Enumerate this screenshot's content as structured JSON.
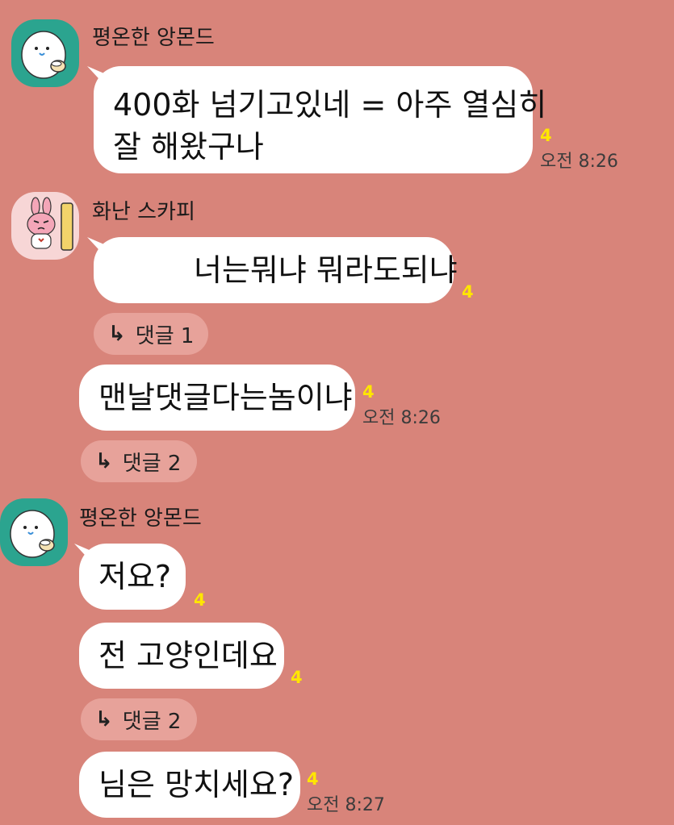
{
  "colors": {
    "background": "#d8847a",
    "bubble": "#ffffff",
    "unread": "#ffe600",
    "reply_pill": "#e7a29a",
    "avatar_green": "#2ba48f",
    "avatar_pink": "#f7d6d6"
  },
  "groups": [
    {
      "sender": "평온한 앙몬드",
      "avatar_icon": "white-bean-character-icon",
      "messages": [
        {
          "lines": [
            "400화 넘기고있네 = 아주 열심히",
            "잘 해왔구나"
          ],
          "unread": "4",
          "time": "오전 8:26"
        }
      ]
    },
    {
      "sender": "화난 스카피",
      "avatar_icon": "angry-pink-rabbit-icon",
      "messages": [
        {
          "text": "너는뭐냐 뭐라도되냐",
          "unread": "4",
          "reply": {
            "icon": "reply-arrow-icon",
            "label": "댓글 1"
          }
        },
        {
          "text": "맨날댓글다는놈이냐",
          "unread": "4",
          "time": "오전 8:26",
          "reply": {
            "icon": "reply-arrow-icon",
            "label": "댓글 2"
          }
        }
      ]
    },
    {
      "sender": "평온한 앙몬드",
      "avatar_icon": "white-bean-character-icon",
      "messages": [
        {
          "text": "저요?",
          "unread": "4"
        },
        {
          "text": "전 고양인데요",
          "unread": "4",
          "reply": {
            "icon": "reply-arrow-icon",
            "label": "댓글 2"
          }
        },
        {
          "text": "님은 망치세요?",
          "unread": "4",
          "time": "오전 8:27"
        }
      ]
    }
  ]
}
